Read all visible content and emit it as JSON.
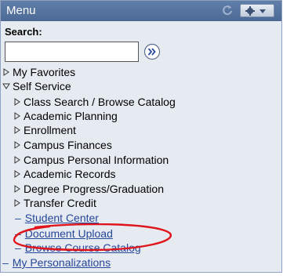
{
  "menu": {
    "title": "Menu",
    "search_label": "Search:",
    "search_value": "",
    "items": [
      {
        "label": "My Favorites"
      },
      {
        "label": "Self Service"
      }
    ],
    "self_service_children": [
      {
        "label": "Class Search / Browse Catalog"
      },
      {
        "label": "Academic Planning"
      },
      {
        "label": "Enrollment"
      },
      {
        "label": "Campus Finances"
      },
      {
        "label": "Campus Personal Information"
      },
      {
        "label": "Academic Records"
      },
      {
        "label": "Degree Progress/Graduation"
      },
      {
        "label": "Transfer Credit"
      }
    ],
    "self_service_links": [
      {
        "label": "Student Center"
      },
      {
        "label": "Document Upload"
      },
      {
        "label": "Browse Course Catalog"
      }
    ],
    "bottom_link": {
      "label": "My Personalizations"
    }
  },
  "colors": {
    "titlebar": "#5472a0",
    "panel": "#e6eaf1",
    "link": "#26479a",
    "annotation_circle": "#e0141b"
  },
  "icons": {
    "refresh": "refresh-icon",
    "options": "gear-icon",
    "go": "double-chevron-right-icon",
    "collapsed": "triangle-right-icon",
    "expanded": "triangle-down-icon"
  }
}
